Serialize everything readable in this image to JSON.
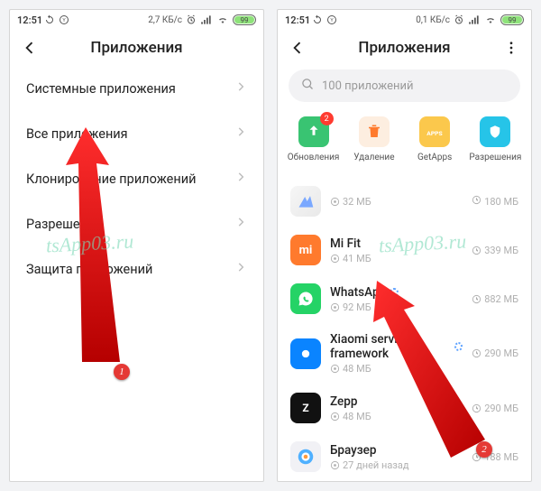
{
  "status": {
    "time": "12:51",
    "net_speed": "2,7 КБ/с",
    "net_speed2": "0,1 КБ/с",
    "battery": "99"
  },
  "screen1": {
    "title": "Приложения",
    "rows": [
      "Системные приложения",
      "Все приложения",
      "Клонирование приложений",
      "Разрешения",
      "Защита приложений"
    ]
  },
  "screen2": {
    "title": "Приложения",
    "search_placeholder": "100 приложений",
    "actions": [
      {
        "label": "Обновления",
        "badge": "2"
      },
      {
        "label": "Удаление",
        "badge": ""
      },
      {
        "label": "GetApps",
        "badge": ""
      },
      {
        "label": "Разрешения",
        "badge": ""
      }
    ],
    "apps": [
      {
        "name": "",
        "size": "32 МБ",
        "time": "180 МБ"
      },
      {
        "name": "Mi Fit",
        "size": "41 МБ",
        "time": "339 МБ"
      },
      {
        "name": "WhatsApp",
        "size": "92 МБ",
        "time": "882 МБ"
      },
      {
        "name": "Xiaomi service framework",
        "size": "48 МБ",
        "time": "290 МБ"
      },
      {
        "name": "Zepp",
        "size": "48 МБ",
        "time": "290 МБ"
      },
      {
        "name": "Браузер",
        "size": "27 дней назад",
        "time": "188 МБ"
      }
    ]
  },
  "markers": {
    "m1": "1",
    "m2": "2"
  },
  "watermark": "tsApp03.ru"
}
